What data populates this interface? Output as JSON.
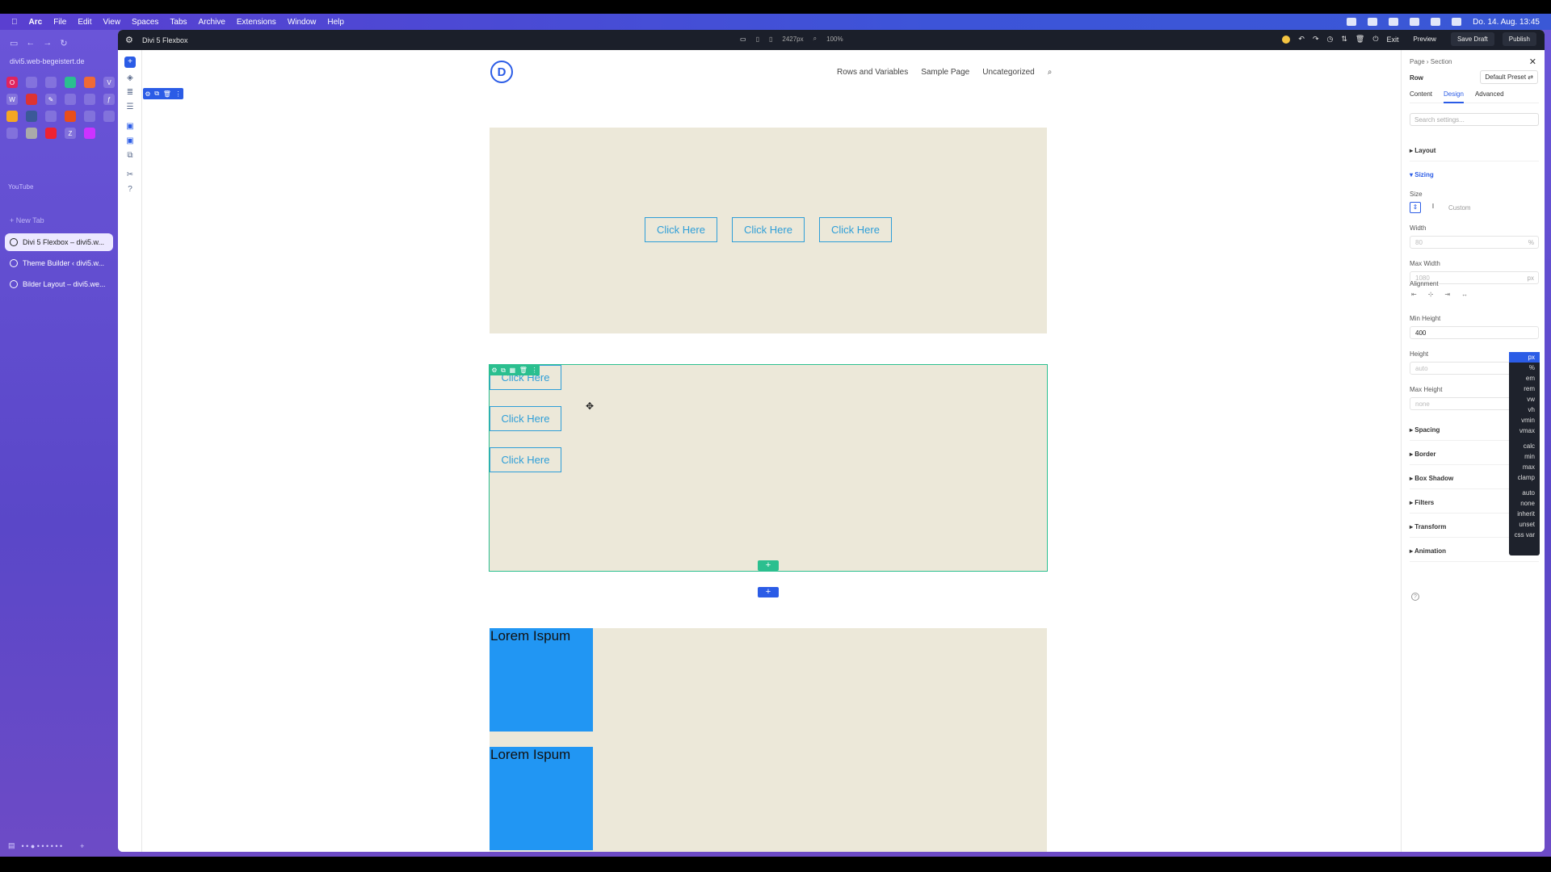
{
  "menubar": {
    "app": "Arc",
    "items": [
      "File",
      "Edit",
      "View",
      "Spaces",
      "Tabs",
      "Archive",
      "Extensions",
      "Window",
      "Help"
    ],
    "clock": "Do. 14. Aug. 13:45"
  },
  "arc": {
    "url": "divi5.web-begeistert.de",
    "section_label": "YouTube",
    "new_tab": "+ New Tab",
    "tabs": [
      {
        "label": "Divi 5 Flexbox – divi5.w...",
        "active": true
      },
      {
        "label": "Theme Builder ‹ divi5.w..."
      },
      {
        "label": "Bilder Layout – divi5.we..."
      }
    ]
  },
  "topbar": {
    "title": "Divi 5 Flexbox",
    "width_readout": "2427px",
    "zoom": "100%",
    "exit": "Exit",
    "preview": "Preview",
    "save_draft": "Save Draft",
    "publish": "Publish"
  },
  "site": {
    "logo": "D",
    "nav": [
      "Rows and Variables",
      "Sample Page",
      "Uncategorized"
    ]
  },
  "buttons": {
    "label": "Click Here"
  },
  "lorem": [
    "Lorem Ispum",
    "Lorem Ispum"
  ],
  "settings": {
    "breadcrumb": "Page › Section",
    "element": "Row",
    "preset": "Default Preset ⇄",
    "tabs": [
      "Content",
      "Design",
      "Advanced"
    ],
    "search_placeholder": "Search settings...",
    "layout": "Layout",
    "sizing": "Sizing",
    "size_label": "Size",
    "custom": "Custom",
    "width_label": "Width",
    "width_value": "80",
    "width_unit": "%",
    "maxwidth_label": "Max Width",
    "maxwidth_value": "1080",
    "maxwidth_unit": "px",
    "alignment_label": "Alignment",
    "minheight_label": "Min Height",
    "minheight_value": "400",
    "height_label": "Height",
    "height_value": "auto",
    "maxheight_label": "Max Height",
    "maxheight_value": "none",
    "groups": [
      "Spacing",
      "Border",
      "Box Shadow",
      "Filters",
      "Transform",
      "Animation"
    ]
  },
  "unit_menu": {
    "selected": "px",
    "units": [
      "%",
      "em",
      "rem",
      "vw",
      "vh",
      "vmin",
      "vmax"
    ],
    "functions": [
      "calc",
      "min",
      "max",
      "clamp"
    ],
    "keywords": [
      "auto",
      "none",
      "inherit",
      "unset",
      "css var"
    ]
  }
}
